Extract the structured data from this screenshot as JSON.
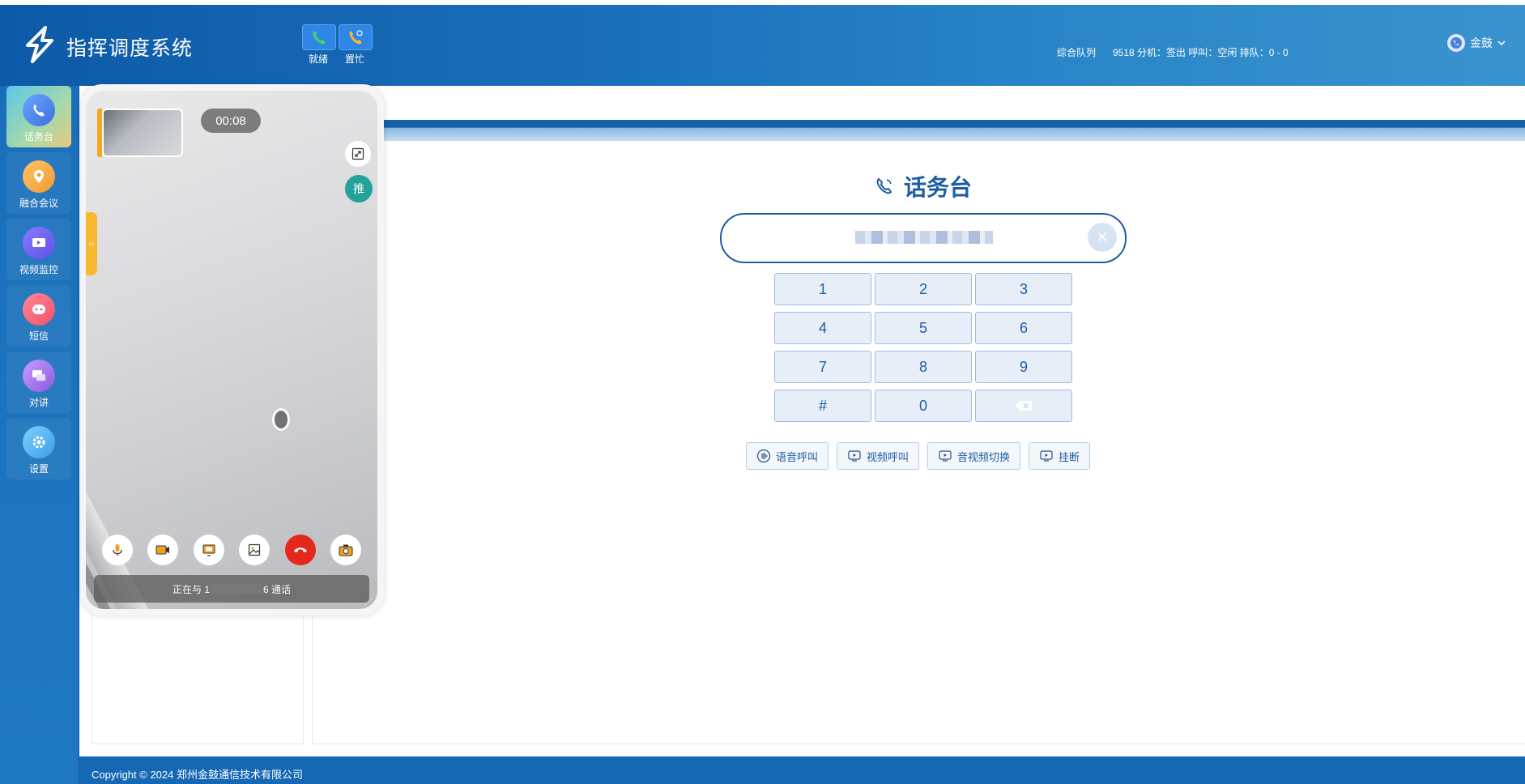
{
  "app": {
    "title": "指挥调度系统"
  },
  "status_buttons": [
    {
      "label": "就绪",
      "icon": "phone-ready-icon",
      "color": "#2f86e6"
    },
    {
      "label": "置忙",
      "icon": "phone-busy-icon",
      "color": "#2f86e6"
    }
  ],
  "queue": {
    "name": "综合队列",
    "info": "9518  分机：签出  呼叫：空闲  排队：0 - 0"
  },
  "user": {
    "name": "金鼓"
  },
  "sidebar": {
    "items": [
      {
        "label": "话务台",
        "icon": "phone-icon",
        "active": true
      },
      {
        "label": "融合会议",
        "icon": "location-pin-icon",
        "active": false
      },
      {
        "label": "视频监控",
        "icon": "video-icon",
        "active": false
      },
      {
        "label": "短信",
        "icon": "message-icon",
        "active": false
      },
      {
        "label": "对讲",
        "icon": "chat-icon",
        "active": false
      },
      {
        "label": "设置",
        "icon": "gear-icon",
        "active": false
      }
    ]
  },
  "console": {
    "title": "话务台",
    "input_value": "",
    "keys": [
      "1",
      "2",
      "3",
      "4",
      "5",
      "6",
      "7",
      "8",
      "9",
      "#",
      "0",
      ""
    ],
    "actions": [
      {
        "label": "语音呼叫",
        "icon": "voice-icon"
      },
      {
        "label": "视频呼叫",
        "icon": "video-play-icon"
      },
      {
        "label": "音视频切换",
        "icon": "switch-icon"
      },
      {
        "label": "挂断",
        "icon": "hangup-icon"
      }
    ]
  },
  "video_call": {
    "timer": "00:08",
    "push_label": "推",
    "side_tab_label": "‹›",
    "status_prefix": "正在与 1",
    "status_suffix": "6 通话",
    "controls": [
      "microphone-icon",
      "camera-icon",
      "screen-share-icon",
      "image-icon",
      "hangup-icon",
      "snapshot-icon"
    ]
  },
  "footer": {
    "copyright": "Copyright © 2024 郑州金鼓通信技术有限公司"
  },
  "colors": {
    "primary": "#1c5da4",
    "accent": "#2f86e6",
    "hangup": "#e5281c",
    "push": "#23a19a"
  }
}
